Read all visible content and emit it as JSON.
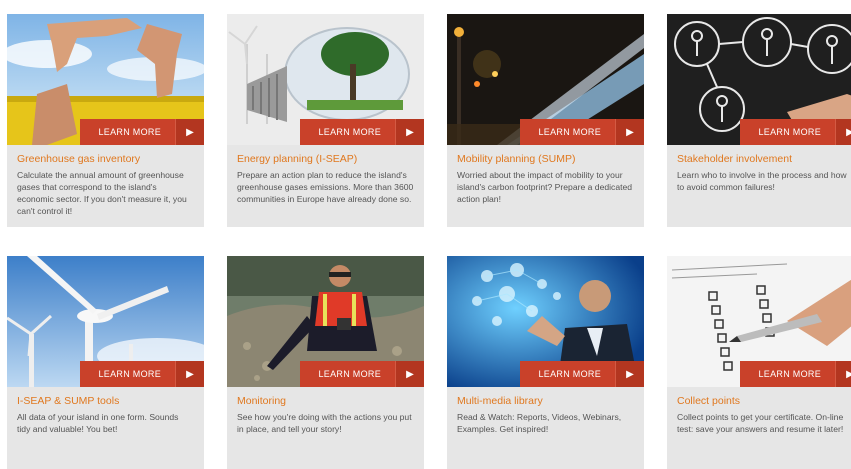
{
  "learn_more_label": "LEARN MORE",
  "colors": {
    "learn_more_bg": "#c9412a",
    "title_orange": "#e0781f",
    "card_bg": "#e6e6e6"
  },
  "cards": [
    {
      "title": "Greenhouse gas inventory",
      "description": "Calculate the annual amount of greenhouse gases that correspond to the island's economic sector. If you don't measure it, you can't control it!"
    },
    {
      "title": "Energy planning (I-SEAP)",
      "description": "Prepare an action plan to reduce the island's greenhouse gases emissions. More than 3600 communities in Europe have already done so."
    },
    {
      "title": "Mobility planning (SUMP)",
      "description": "Worried about the impact of mobility to your island's carbon footprint? Prepare a dedicated action plan!"
    },
    {
      "title": "Stakeholder involvement",
      "description": "Learn who to involve in the process and how to avoid common failures!"
    },
    {
      "title": "I-SEAP & SUMP tools",
      "description": "All data of your island in one form. Sounds tidy and valuable! You bet!"
    },
    {
      "title": "Monitoring",
      "description": "See how you're doing with the actions you put in place, and tell your story!"
    },
    {
      "title": "Multi-media library",
      "description": "Read & Watch: Reports, Videos, Webinars, Examples. Get inspired!"
    },
    {
      "title": "Collect points",
      "description": "Collect points to get your certificate. On-line test: save your answers and resume it later!"
    }
  ]
}
